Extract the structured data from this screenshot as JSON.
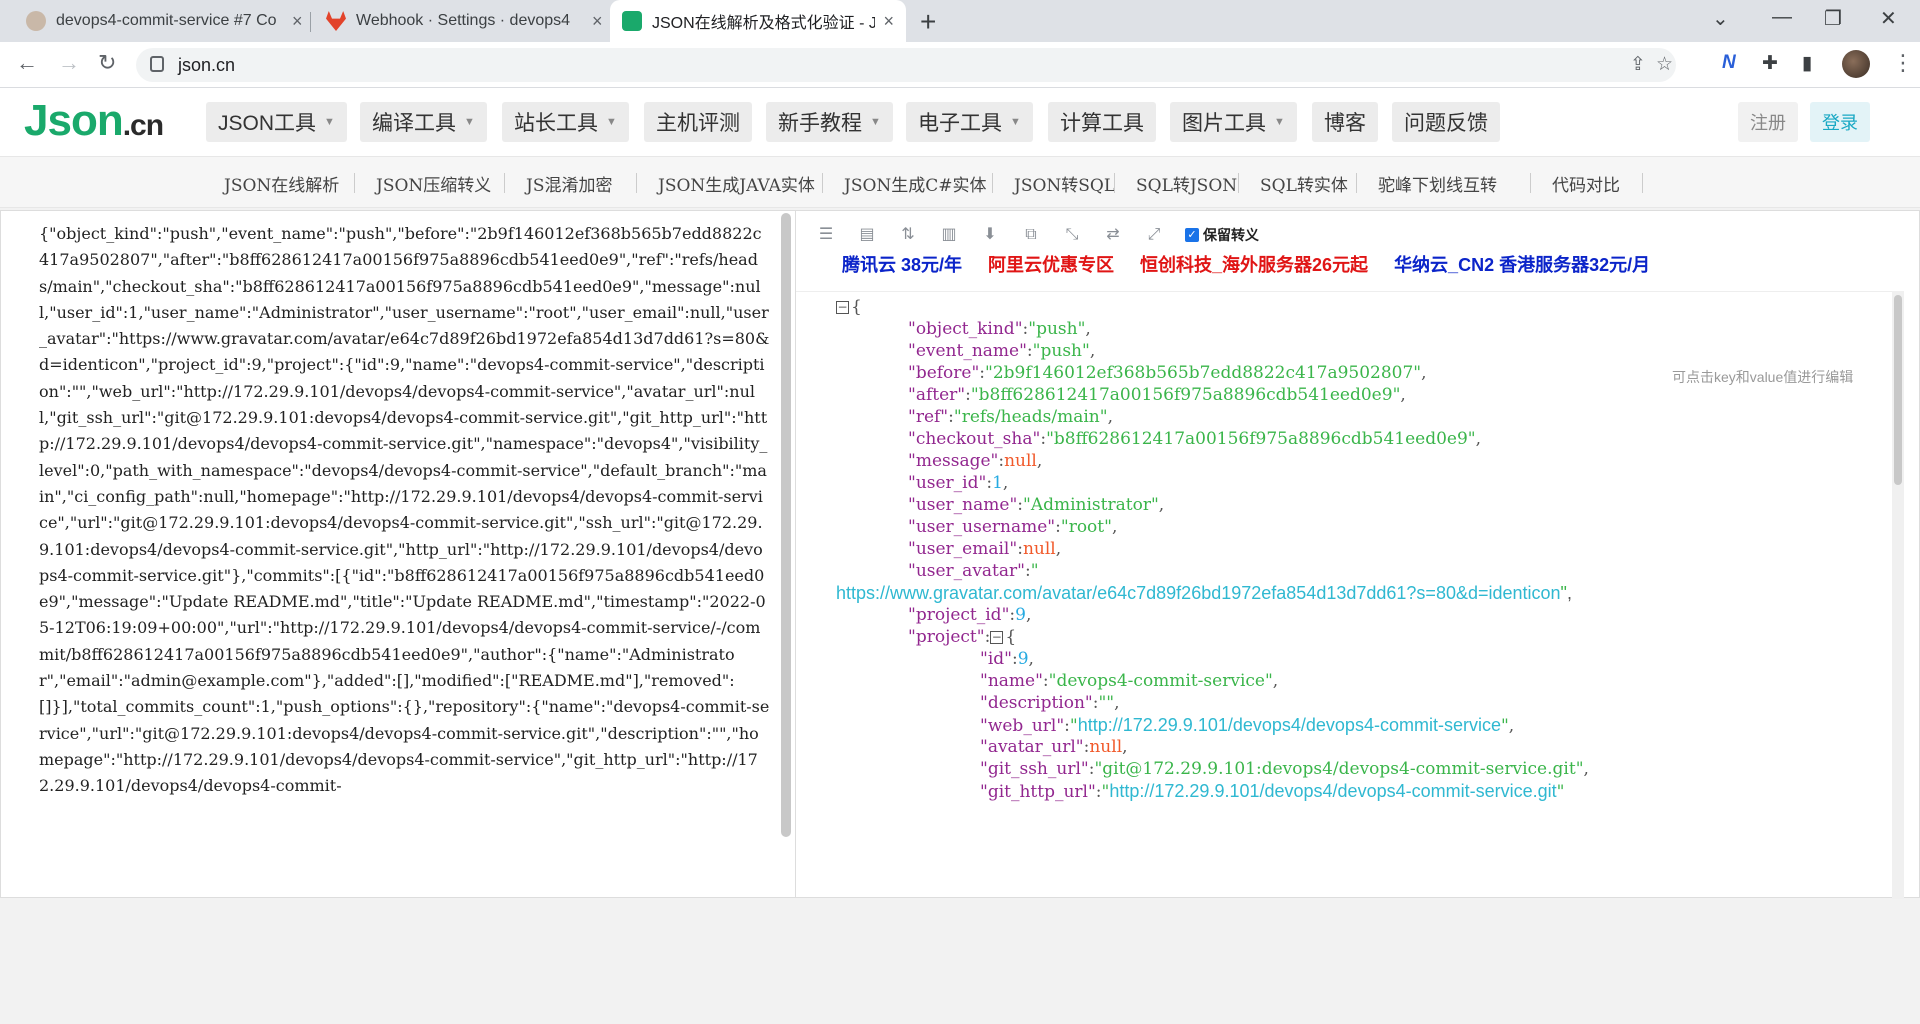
{
  "browser": {
    "tabs": [
      {
        "title": "devops4-commit-service #7 Co",
        "close": "×"
      },
      {
        "title": "Webhook · Settings · devops4",
        "close": "×"
      },
      {
        "title": "JSON在线解析及格式化验证 - JS",
        "close": "×"
      }
    ],
    "new_tab": "+",
    "url": "json.cn"
  },
  "site": {
    "logo_main": "Json",
    "logo_suffix": ".cn",
    "menus": [
      "JSON工具",
      "编译工具",
      "站长工具",
      "主机评测",
      "新手教程",
      "电子工具",
      "计算工具",
      "图片工具",
      "博客",
      "问题反馈"
    ],
    "register": "注册",
    "login": "登录",
    "subnav": [
      "JSON在线解析",
      "JSON压缩转义",
      "JS混淆加密",
      "JSON生成JAVA实体",
      "JSON生成C#实体",
      "JSON转SQL",
      "SQL转JSON",
      "SQL转实体",
      "驼峰下划线互转",
      "代码对比"
    ]
  },
  "raw_json": "{\"object_kind\":\"push\",\"event_name\":\"push\",\"before\":\"2b9f146012ef368b565b7edd8822c417a9502807\",\"after\":\"b8ff628612417a00156f975a8896cdb541eed0e9\",\"ref\":\"refs/heads/main\",\"checkout_sha\":\"b8ff628612417a00156f975a8896cdb541eed0e9\",\"message\":null,\"user_id\":1,\"user_name\":\"Administrator\",\"user_username\":\"root\",\"user_email\":null,\"user_avatar\":\"https://www.gravatar.com/avatar/e64c7d89f26bd1972efa854d13d7dd61?s=80&d=identicon\",\"project_id\":9,\"project\":{\"id\":9,\"name\":\"devops4-commit-service\",\"description\":\"\",\"web_url\":\"http://172.29.9.101/devops4/devops4-commit-service\",\"avatar_url\":null,\"git_ssh_url\":\"git@172.29.9.101:devops4/devops4-commit-service.git\",\"git_http_url\":\"http://172.29.9.101/devops4/devops4-commit-service.git\",\"namespace\":\"devops4\",\"visibility_level\":0,\"path_with_namespace\":\"devops4/devops4-commit-service\",\"default_branch\":\"main\",\"ci_config_path\":null,\"homepage\":\"http://172.29.9.101/devops4/devops4-commit-service\",\"url\":\"git@172.29.9.101:devops4/devops4-commit-service.git\",\"ssh_url\":\"git@172.29.9.101:devops4/devops4-commit-service.git\",\"http_url\":\"http://172.29.9.101/devops4/devops4-commit-service.git\"},\"commits\":[{\"id\":\"b8ff628612417a00156f975a8896cdb541eed0e9\",\"message\":\"Update README.md\",\"title\":\"Update README.md\",\"timestamp\":\"2022-05-12T06:19:09+00:00\",\"url\":\"http://172.29.9.101/devops4/devops4-commit-service/-/commit/b8ff628612417a00156f975a8896cdb541eed0e9\",\"author\":{\"name\":\"Administrator\",\"email\":\"admin@example.com\"},\"added\":[],\"modified\":[\"README.md\"],\"removed\":[]}],\"total_commits_count\":1,\"push_options\":{},\"repository\":{\"name\":\"devops4-commit-service\",\"url\":\"git@172.29.9.101:devops4/devops4-commit-service.git\",\"description\":\"\",\"homepage\":\"http://172.29.9.101/devops4/devops4-commit-service\",\"git_http_url\":\"http://172.29.9.101/devops4/devops4-commit-",
  "viewer": {
    "keep_escape_label": "保留转义",
    "ads": [
      {
        "text": "腾讯云 38元/年",
        "color": "#0b24c9"
      },
      {
        "text": "阿里云优惠专区",
        "color": "#e01515"
      },
      {
        "text": "恒创科技_海外服务器26元起",
        "color": "#e01515"
      },
      {
        "text": "华纳云_CN2 香港服务器32元/月",
        "color": "#0b24c9"
      }
    ],
    "hint": "可点击key和value值进行编辑",
    "fields": {
      "object_kind": "push",
      "event_name": "push",
      "before": "2b9f146012ef368b565b7edd8822c417a9502807",
      "after": "b8ff628612417a00156f975a8896cdb541eed0e9",
      "ref": "refs/heads/main",
      "checkout_sha": "b8ff628612417a00156f975a8896cdb541eed0e9",
      "message": "null",
      "user_id": "1",
      "user_name": "Administrator",
      "user_username": "root",
      "user_email": "null",
      "user_avatar": "https://www.gravatar.com/avatar/e64c7d89f26bd1972efa854d13d7dd61?s=80&d=identicon",
      "project_id": "9",
      "project_id_inner": "9",
      "project_name": "devops4-commit-service",
      "project_description": "",
      "project_web_url": "http://172.29.9.101/devops4/devops4-commit-service",
      "project_avatar_url": "null",
      "project_git_ssh_url": "git@172.29.9.101:devops4/devops4-commit-service.git",
      "project_git_http_url": "http://172.29.9.101/devops4/devops4-commit-service.git"
    }
  }
}
